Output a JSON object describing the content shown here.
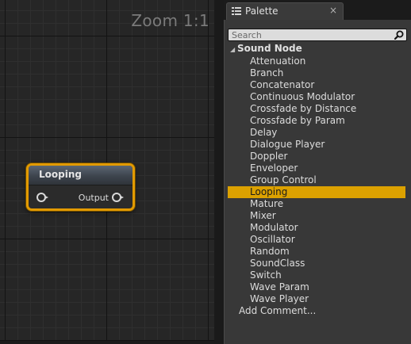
{
  "graph": {
    "zoom_label": "Zoom 1:1",
    "node": {
      "title": "Looping",
      "output_label": "Output"
    },
    "colors": {
      "selection_border": "#e29a00",
      "grid_bg": "#262626"
    }
  },
  "palette": {
    "tab_label": "Palette",
    "tab_close": "×",
    "search_placeholder": "Search",
    "category": {
      "arrow": "◢",
      "label": "Sound Node"
    },
    "items": [
      "Attenuation",
      "Branch",
      "Concatenator",
      "Continuous Modulator",
      "Crossfade by Distance",
      "Crossfade by Param",
      "Delay",
      "Dialogue Player",
      "Doppler",
      "Enveloper",
      "Group Control",
      "Looping",
      "Mature",
      "Mixer",
      "Modulator",
      "Oscillator",
      "Random",
      "SoundClass",
      "Switch",
      "Wave Param",
      "Wave Player"
    ],
    "selected_item": "Looping",
    "add_comment": "Add Comment...",
    "colors": {
      "selected_bg": "#dca100"
    }
  }
}
